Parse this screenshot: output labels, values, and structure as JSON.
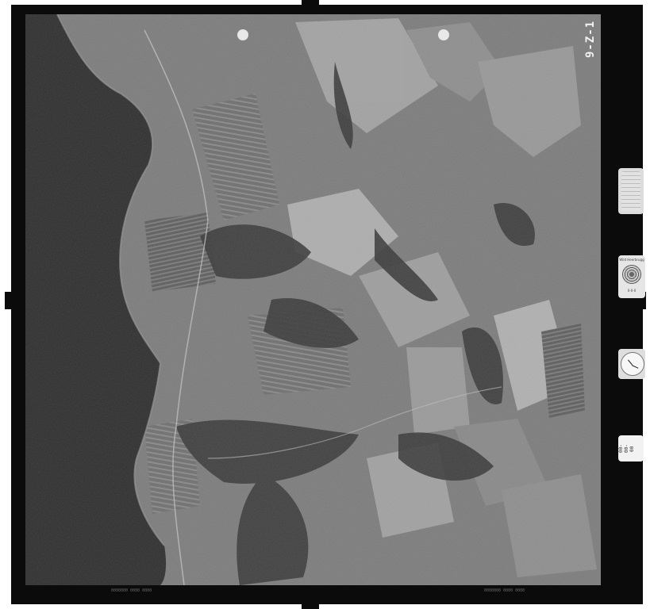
{
  "frame_number": "9-Z-1",
  "strip": {
    "bottom_left": "0000000 0000 0000",
    "bottom_right": "0000000 0000 0000"
  },
  "instruments": {
    "level_label_top": "Wild Heerbrugg",
    "level_label_bottom": "0-0-0",
    "counter_text": "00-00-00"
  },
  "colors": {
    "frame": "#0b0b0b",
    "water": "#2f2f2f",
    "land": "#7c7c7c"
  }
}
